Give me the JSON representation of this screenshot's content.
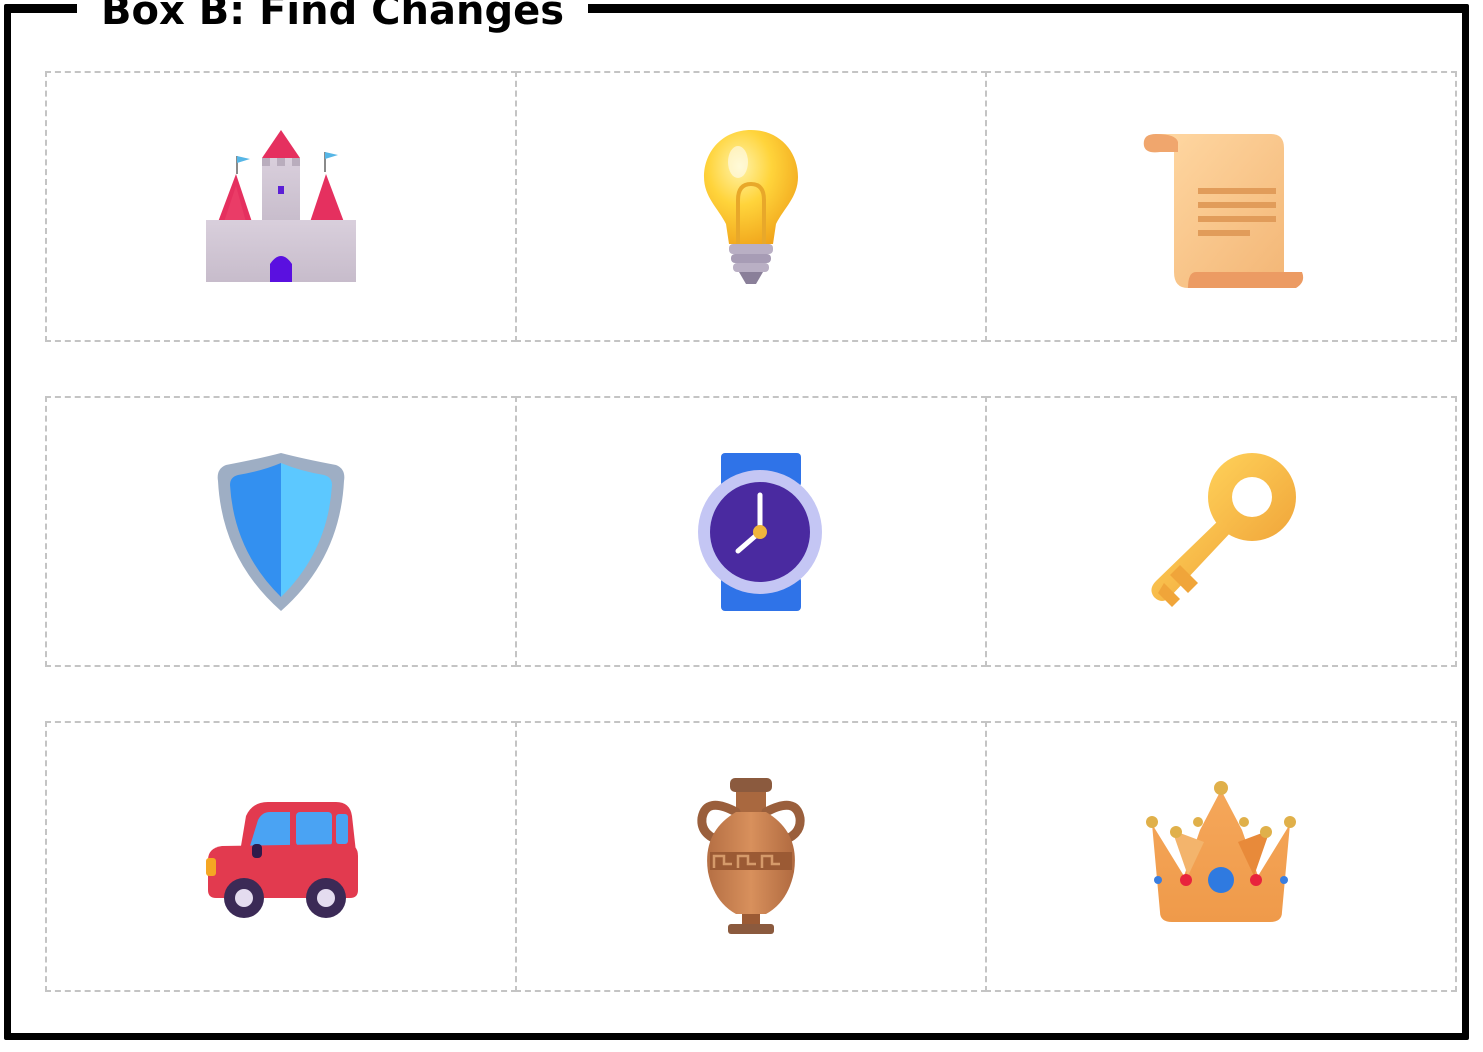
{
  "box": {
    "title": "Box B: Find Changes"
  },
  "grid": {
    "rows": 3,
    "columns": 3,
    "items": [
      {
        "icon": "castle-icon"
      },
      {
        "icon": "light-bulb-icon"
      },
      {
        "icon": "scroll-icon"
      },
      {
        "icon": "shield-icon"
      },
      {
        "icon": "wristwatch-icon"
      },
      {
        "icon": "key-icon"
      },
      {
        "icon": "car-icon"
      },
      {
        "icon": "amphora-icon"
      },
      {
        "icon": "crown-icon"
      }
    ]
  },
  "colors": {
    "frame": "#000000",
    "cell_border": "#c4c4c4",
    "background": "#ffffff"
  }
}
